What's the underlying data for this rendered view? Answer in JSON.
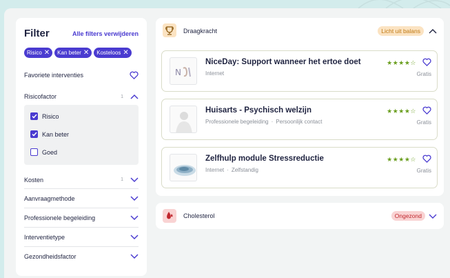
{
  "filter": {
    "title": "Filter",
    "clear_all": "Alle filters verwijderen",
    "chips": [
      "Risico",
      "Kan beter",
      "Kosteloos"
    ],
    "favorites_label": "Favoriete interventies",
    "risk_factor": {
      "label": "Risicofactor",
      "count": "1"
    },
    "risk_options": [
      {
        "label": "Risico",
        "checked": true
      },
      {
        "label": "Kan beter",
        "checked": true
      },
      {
        "label": "Goed",
        "checked": false
      }
    ],
    "costs": {
      "label": "Kosten",
      "count": "1"
    },
    "sections": [
      "Aanvraagmethode",
      "Professionele begeleiding",
      "Interventietype",
      "Gezondheidsfactor"
    ]
  },
  "draagkracht": {
    "title": "Draagkracht",
    "badge": "Licht uit balans",
    "badge_color": "#fbe3c2",
    "items": [
      {
        "title": "NiceDay: Support wanneer het ertoe doet",
        "meta": [
          "Internet"
        ],
        "rating": 4,
        "price": "Gratis",
        "thumb_icon": "niceday-logo-icon"
      },
      {
        "title": "Huisarts - Psychisch welzijn",
        "meta": [
          "Professionele begeleiding",
          "Persoonlijk contact"
        ],
        "rating": 4,
        "price": "Gratis",
        "thumb_icon": "doctor-photo-icon"
      },
      {
        "title": "Zelfhulp module Stressreductie",
        "meta": [
          "Internet",
          "Zelfstandig"
        ],
        "rating": 4,
        "price": "Gratis",
        "thumb_icon": "stress-module-icon"
      }
    ]
  },
  "cholesterol": {
    "title": "Cholesterol",
    "badge": "Ongezond",
    "badge_color": "#f9d3d3"
  },
  "colors": {
    "accent": "#4a3bd0",
    "star": "#6a9e1f",
    "bg": "#d3ecec"
  }
}
